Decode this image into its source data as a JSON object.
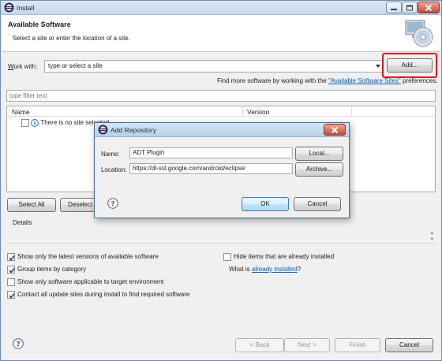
{
  "window": {
    "title": "Install",
    "header_title": "Available Software",
    "header_subtitle": "Select a site or enter the location of a site."
  },
  "work_with": {
    "label_u": "W",
    "label_rest": "ork with:",
    "value": "type or select a site",
    "add_button": "Add..."
  },
  "find_more": {
    "prefix": "Find more software by working with the ",
    "link": "\"Available Software Sites\"",
    "suffix": " preferences."
  },
  "filter": {
    "placeholder": "type filter text"
  },
  "table": {
    "columns": [
      "Name",
      "Version"
    ],
    "rows": [
      {
        "name": "There is no site selected."
      }
    ]
  },
  "buttons": {
    "select_all": "Select All",
    "deselect_all": "Deselect All",
    "back": "< Back",
    "next": "Next >",
    "finish": "Finish",
    "cancel": "Cancel"
  },
  "details": {
    "label": "Details"
  },
  "options": {
    "latest": {
      "label": "Show only the latest versions of available software",
      "checked": true
    },
    "group": {
      "label": "Group items by category",
      "checked": true
    },
    "applicable": {
      "label": "Show only software applicable to target environment",
      "checked": false
    },
    "contact": {
      "label": "Contact all update sites during install to find required software",
      "checked": true
    },
    "hide": {
      "label": "Hide items that are already installed",
      "checked": false
    },
    "what_is_prefix": "What is ",
    "what_is_link": "already installed",
    "what_is_suffix": "?"
  },
  "dialog": {
    "title": "Add Repository",
    "name_label": "Name:",
    "name_value": "ADT Plugin",
    "location_label": "Location:",
    "location_value": "https://dl-ssl.google.com/android/eclipse",
    "local_button": "Local...",
    "archive_button": "Archive...",
    "ok_button": "OK",
    "cancel_button": "Cancel"
  },
  "colors": {
    "highlight_box": "#d11c1c",
    "link": "#0b5cb8",
    "default_button_border": "#3c7fb1"
  }
}
